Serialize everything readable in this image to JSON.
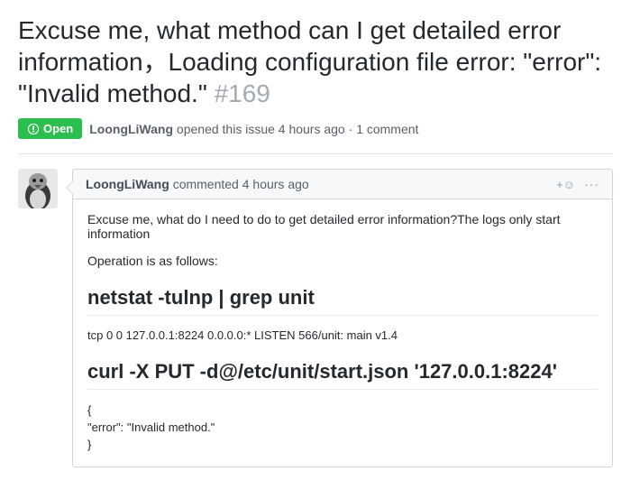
{
  "issue": {
    "title": "Excuse me, what method can I get detailed error information，Loading configuration file error: \"error\": \"Invalid method.\"",
    "number": "#169",
    "status": "Open",
    "author": "LoongLiWang",
    "opened_text": "opened this issue 4 hours ago",
    "comment_count": "1 comment"
  },
  "comment": {
    "author": "LoongLiWang",
    "action": "commented",
    "time": "4 hours ago",
    "body": {
      "p1": "Excuse me, what do I need to do to get detailed error information?The logs only start information",
      "p2": "Operation is as follows:",
      "h1": "netstat -tulnp | grep unit",
      "out1": "tcp 0 0 127.0.0.1:8224 0.0.0.0:* LISTEN 566/unit: main v1.4",
      "h2": "curl -X PUT -d@/etc/unit/start.json '127.0.0.1:8224'",
      "json_l1": "{",
      "json_l2": "\"error\": \"Invalid method.\"",
      "json_l3": "}"
    }
  },
  "icons": {
    "kebab": "···",
    "plus": "+",
    "smiley": "☺"
  }
}
